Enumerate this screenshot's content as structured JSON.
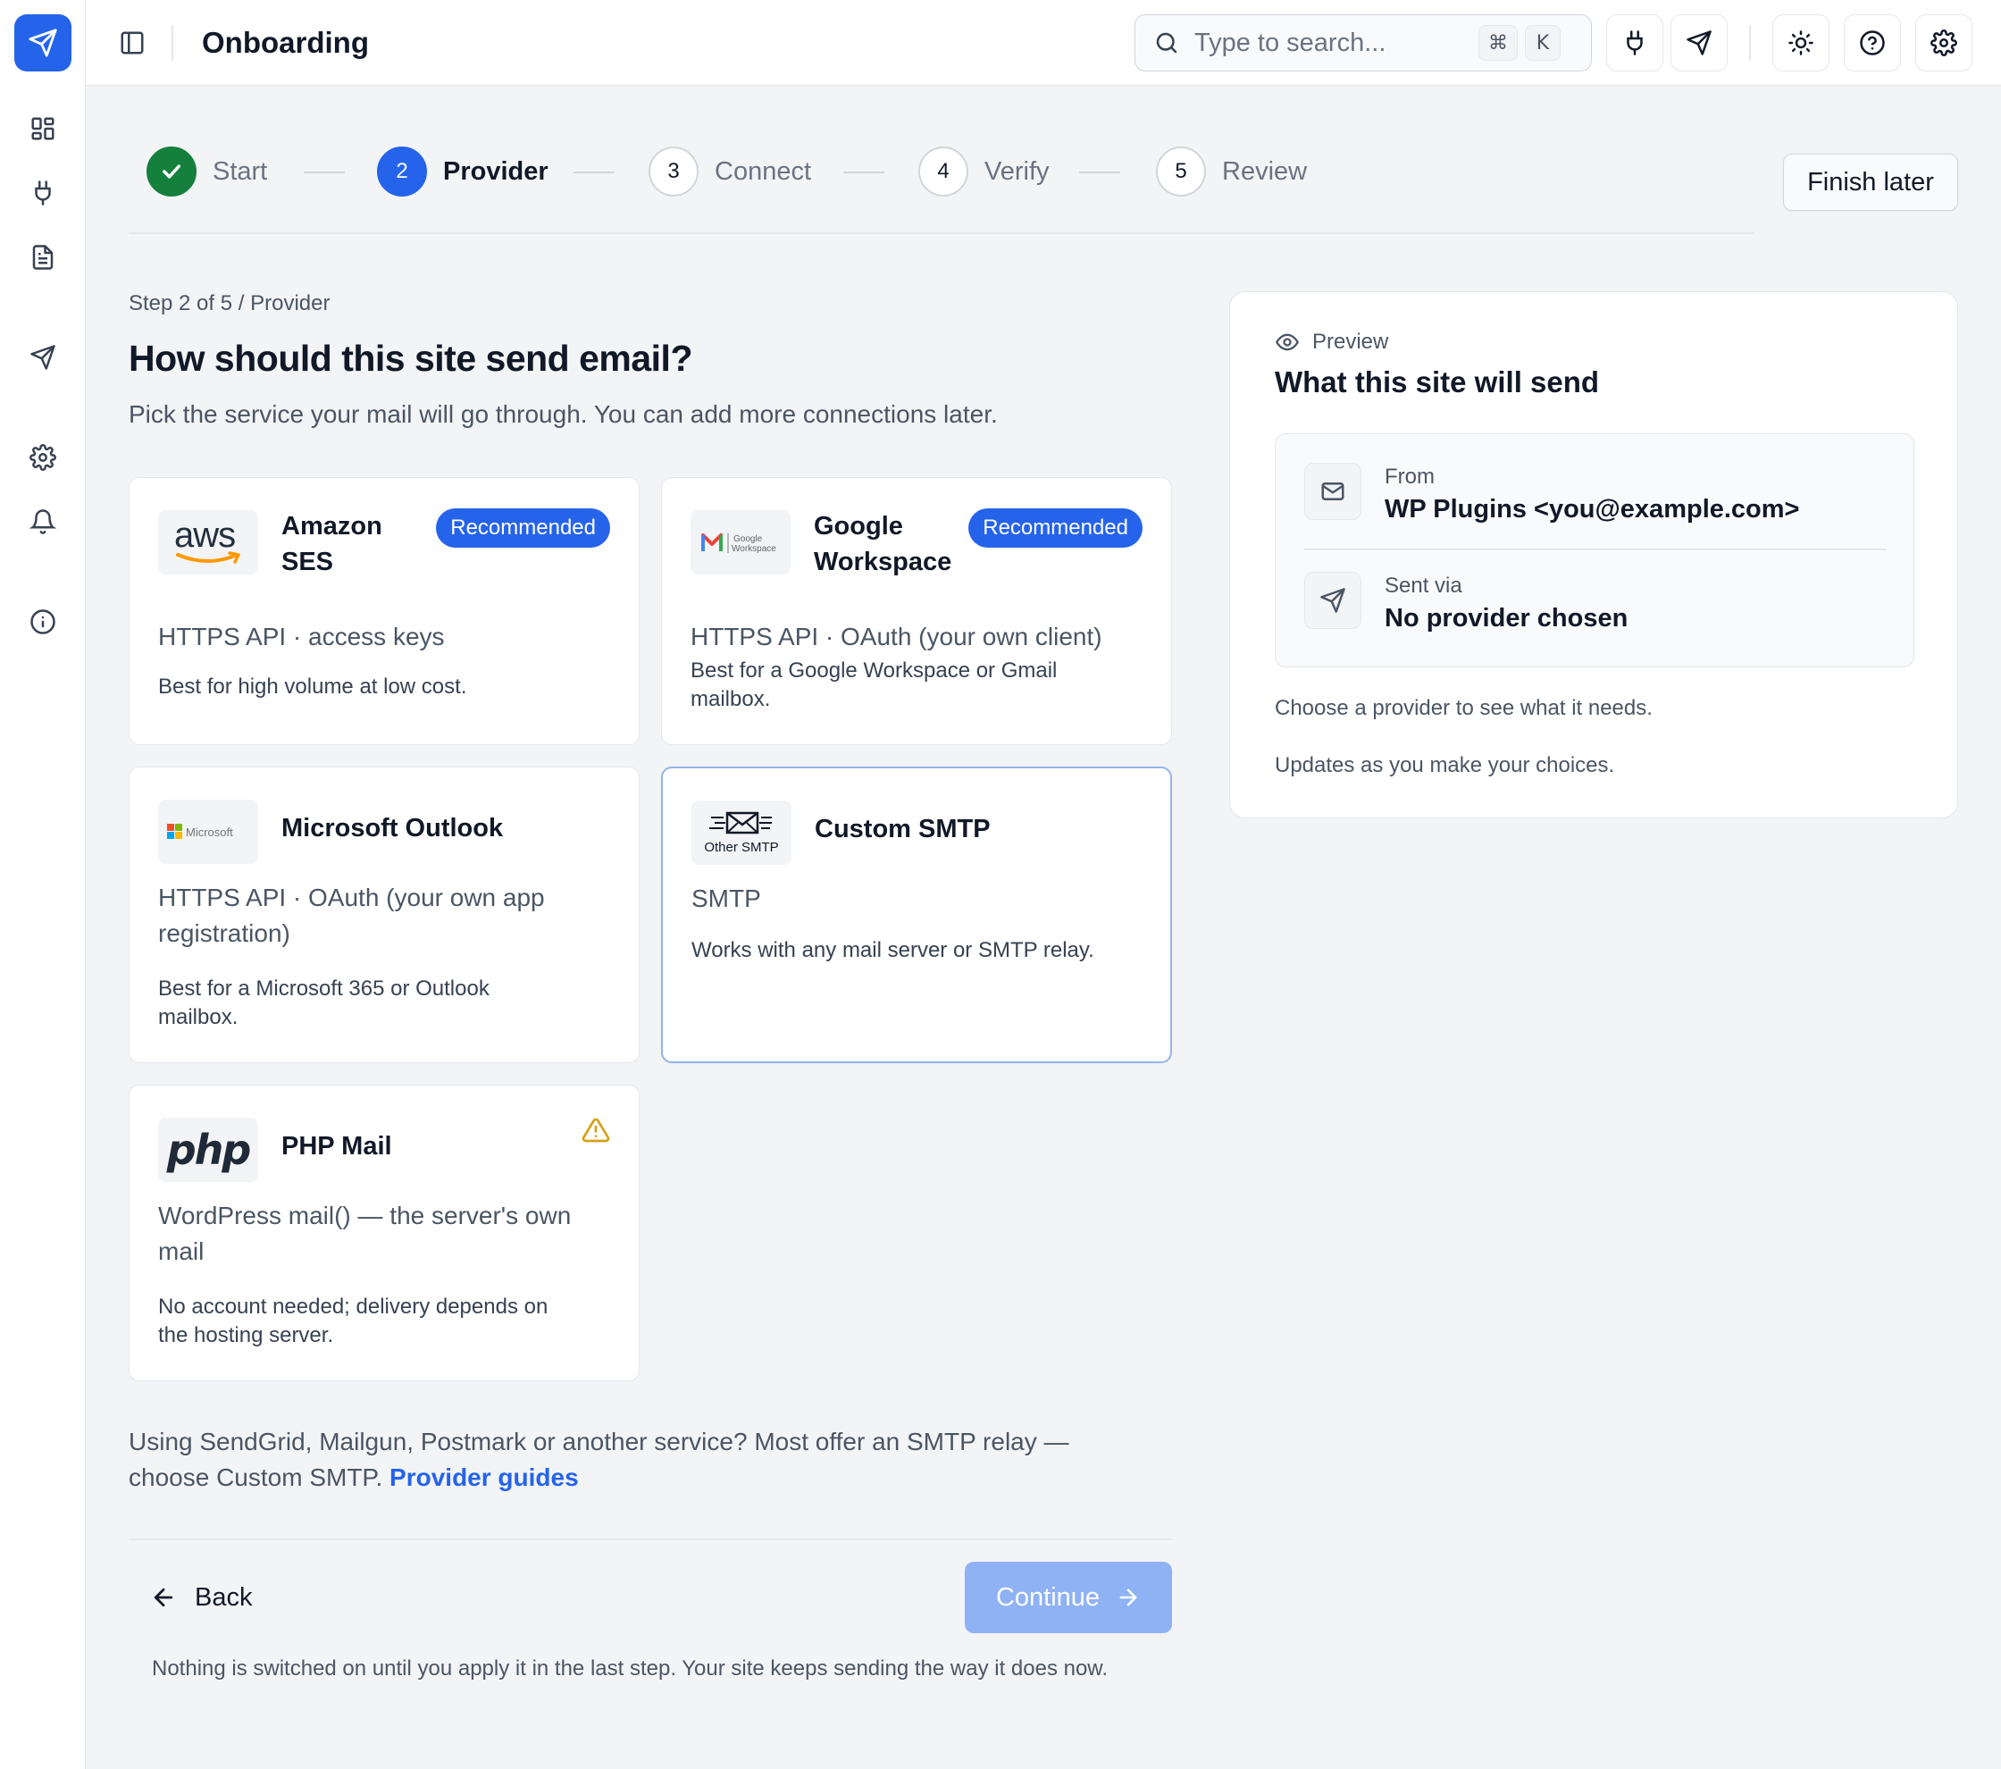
{
  "app": {
    "title": "Onboarding"
  },
  "search": {
    "placeholder": "Type to search...",
    "shortcut_mod": "⌘",
    "shortcut_key": "K"
  },
  "rail": {
    "items": [
      "send-icon",
      "dashboard-icon",
      "plug-icon",
      "document-icon",
      "send-icon",
      "gear-icon",
      "bell-icon",
      "info-icon"
    ]
  },
  "stepper": {
    "steps": [
      {
        "number": "",
        "label": "Start",
        "state": "done"
      },
      {
        "number": "2",
        "label": "Provider",
        "state": "active"
      },
      {
        "number": "3",
        "label": "Connect",
        "state": "todo"
      },
      {
        "number": "4",
        "label": "Verify",
        "state": "todo"
      },
      {
        "number": "5",
        "label": "Review",
        "state": "todo"
      }
    ],
    "finish_later": "Finish later"
  },
  "main": {
    "crumb": "Step 2 of 5 / Provider",
    "title": "How should this site send email?",
    "subtitle": "Pick the service your mail will go through. You can add more connections later."
  },
  "providers": [
    {
      "logo": "aws",
      "logo_text": "aws",
      "name_line1": "Amazon",
      "name_line2": "SES",
      "badge": "Recommended",
      "method": "HTTPS API · access keys",
      "desc_line1": "Best for high volume at low cost.",
      "desc_line2": ""
    },
    {
      "logo": "google-workspace",
      "logo_text": "Google Workspace",
      "name_line1": "Google",
      "name_line2": "Workspace",
      "badge": "Recommended",
      "method": "HTTPS API · OAuth (your own client)",
      "desc_line1": "Best for a Google Workspace or Gmail",
      "desc_line2": "mailbox."
    },
    {
      "logo": "microsoft",
      "logo_text": "Microsoft",
      "name_line1": "Microsoft Outlook",
      "method_line1": "HTTPS API · OAuth (your own app",
      "method_line2": "registration)",
      "desc_line1": "Best for a Microsoft 365 or Outlook",
      "desc_line2": "mailbox."
    },
    {
      "logo": "other-smtp",
      "logo_text": "Other SMTP",
      "name_line1": "Custom SMTP",
      "method": "SMTP",
      "desc_line1": "Works with any mail server or SMTP relay."
    },
    {
      "logo": "php",
      "logo_text": "php",
      "name_line1": "PHP Mail",
      "method_line1": "WordPress mail() — the server's own",
      "method_line2": "mail",
      "desc_line1": "No account needed; delivery depends on",
      "desc_line2": "the hosting server.",
      "warning": "warning-icon"
    }
  ],
  "hint": {
    "line1": "Using SendGrid, Mailgun, Postmark or another service? Most offer an SMTP relay —",
    "line2": "choose Custom SMTP.",
    "link": "Provider guides"
  },
  "actions": {
    "back": "Back",
    "continue": "Continue",
    "footnote": "Nothing is switched on until you apply it in the last step. Your site keeps sending the way it does now."
  },
  "preview": {
    "eyebrow": "Preview",
    "title": "What this site will send",
    "from_label": "From",
    "from_value": "WP Plugins <you@example.com>",
    "via_label": "Sent via",
    "via_value": "No provider chosen",
    "note1": "Choose a provider to see what it needs.",
    "note2": "Updates as you make your choices."
  },
  "colors": {
    "accent": "#2563eb",
    "success": "#15803d",
    "continue_disabled": "#8fb2f4",
    "warning": "#d4a017"
  }
}
